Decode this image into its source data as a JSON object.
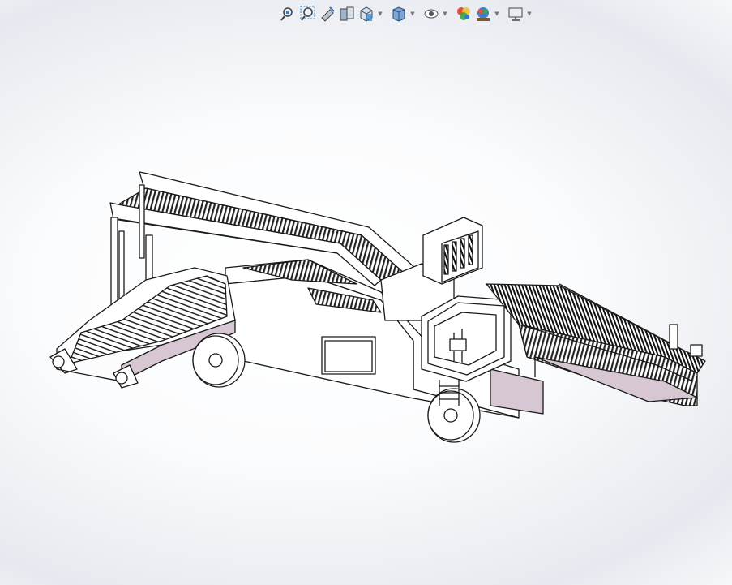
{
  "toolbar": {
    "items": [
      {
        "name": "zoom-to-fit-icon",
        "dropdown": false
      },
      {
        "name": "zoom-to-area-icon",
        "dropdown": false
      },
      {
        "name": "previous-view-icon",
        "dropdown": false
      },
      {
        "name": "section-view-icon",
        "dropdown": false
      },
      {
        "name": "view-orientation-icon",
        "dropdown": true
      },
      {
        "name": "display-style-icon",
        "dropdown": true
      },
      {
        "name": "hide-show-items-icon",
        "dropdown": true
      },
      {
        "name": "edit-appearance-icon",
        "dropdown": false
      },
      {
        "name": "apply-scene-icon",
        "dropdown": true
      },
      {
        "name": "view-settings-icon",
        "dropdown": true
      }
    ],
    "dropdown_glyph": "▼"
  },
  "colors": {
    "accent_blue": "#2f7fd0",
    "model_edge": "#1a1a1a",
    "model_face": "#ffffff",
    "model_shade": "#d7c7d3"
  }
}
